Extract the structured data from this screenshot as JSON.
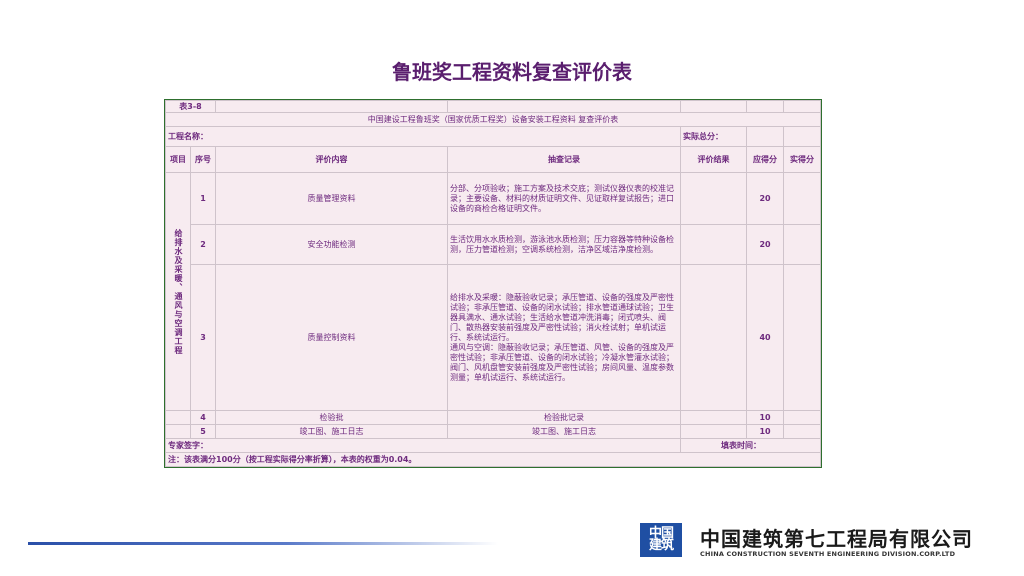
{
  "page": {
    "title": "鲁班奖工程资料复查评价表"
  },
  "table": {
    "table_no": "表3-8",
    "subtitle": "中国建设工程鲁班奖（国家优质工程奖）设备安装工程资料 复查评价表",
    "project_name_label": "工程名称：",
    "actual_total_label": "实际总分：",
    "headers": {
      "item": "项目",
      "seq": "序号",
      "content": "评价内容",
      "record": "抽查记录",
      "result": "评价结果",
      "score": "应得分",
      "actual": "实得分"
    },
    "group_label": "给排水及采暖、通风与空调工程",
    "rows": [
      {
        "seq": "1",
        "content": "质量管理资料",
        "record": "分部、分项验收；施工方案及技术交底；测试仪器仪表的校准记录；主要设备、材料的材质证明文件、见证取样复试报告；进口设备的商检合格证明文件。",
        "score": "20"
      },
      {
        "seq": "2",
        "content": "安全功能检测",
        "record": "生活饮用水水质检测，游泳池水质检测；压力容器等特种设备检测，压力管道检测；空调系统检测，洁净区域洁净度检测。",
        "score": "20"
      },
      {
        "seq": "3",
        "content": "质量控制资料",
        "record": "给排水及采暖：隐蔽验收记录；承压管道、设备的强度及严密性试验；非承压管道、设备的闭水试验；排水管道通球试验；卫生器具满水、通水试验；生活给水管道冲洗消毒；闭式喷头、阀门、散热器安装前强度及严密性试验；消火栓试射；单机试运行、系统试运行。",
        "record2": "通风与空调：隐蔽验收记录；承压管道、风管、设备的强度及严密性试验；非承压管道、设备的闭水试验；冷凝水管灌水试验；阀门、风机盘管安装前强度及严密性试验；房间风量、温度参数测量；单机试运行、系统试运行。",
        "score": "40"
      },
      {
        "seq": "4",
        "content": "检验批",
        "record": "检验批记录",
        "score": "10"
      },
      {
        "seq": "5",
        "content": "竣工图、施工日志",
        "record": "竣工图、施工日志",
        "score": "10"
      }
    ],
    "expert_sign_label": "专家签字：",
    "fill_time_label": "填表时间：",
    "note": "注：该表满分100分（按工程实际得分率折算），本表的权重为0.04。"
  },
  "footer": {
    "logo_text_top": "中国",
    "logo_text_bottom": "建筑",
    "company_cn": "中国建筑第七工程局有限公司",
    "company_en": "CHINA CONSTRUCTION SEVENTH ENGINEERING DIVISION.CORP.LTD",
    "accent_color": "#1f4fa3"
  }
}
